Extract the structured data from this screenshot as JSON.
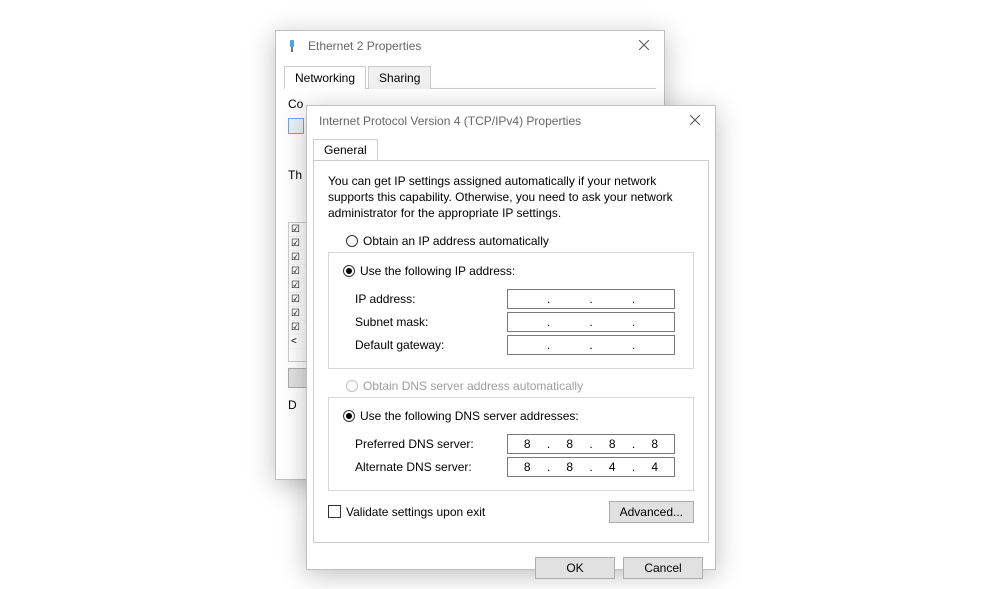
{
  "back_dialog": {
    "title": "Ethernet 2 Properties",
    "tabs": [
      "Networking",
      "Sharing"
    ],
    "connect_label_fragment": "Co",
    "th_fragment": "Th",
    "d_fragment": "D"
  },
  "front_dialog": {
    "title": "Internet Protocol Version 4 (TCP/IPv4) Properties",
    "tab": "General",
    "description": "You can get IP settings assigned automatically if your network supports this capability. Otherwise, you need to ask your network administrator for the appropriate IP settings.",
    "ip_section": {
      "auto_label": "Obtain an IP address automatically",
      "manual_label": "Use the following IP address:",
      "selected": "manual",
      "fields": {
        "ip_address": {
          "label": "IP address:",
          "octets": [
            "",
            "",
            "",
            ""
          ]
        },
        "subnet_mask": {
          "label": "Subnet mask:",
          "octets": [
            "",
            "",
            "",
            ""
          ]
        },
        "default_gateway": {
          "label": "Default gateway:",
          "octets": [
            "",
            "",
            "",
            ""
          ]
        }
      }
    },
    "dns_section": {
      "auto_label": "Obtain DNS server address automatically",
      "auto_disabled": true,
      "manual_label": "Use the following DNS server addresses:",
      "selected": "manual",
      "fields": {
        "preferred": {
          "label": "Preferred DNS server:",
          "octets": [
            "8",
            "8",
            "8",
            "8"
          ]
        },
        "alternate": {
          "label": "Alternate DNS server:",
          "octets": [
            "8",
            "8",
            "4",
            "4"
          ]
        }
      }
    },
    "validate_label": "Validate settings upon exit",
    "validate_checked": false,
    "advanced_button": "Advanced...",
    "ok_button": "OK",
    "cancel_button": "Cancel"
  }
}
